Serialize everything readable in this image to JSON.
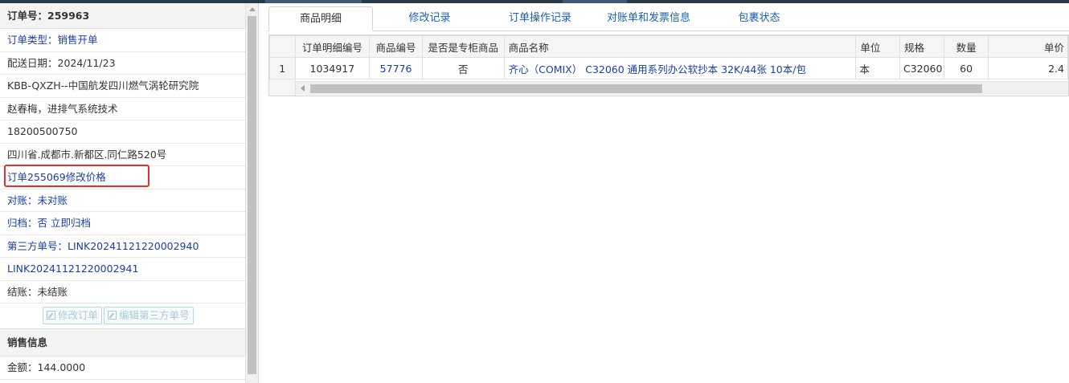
{
  "order": {
    "number_label": "订单号：259963",
    "type_label": "订单类型：",
    "type_value": "销售开单",
    "delivery_date": "配送日期：2024/11/23",
    "customer": "KBB-QXZH--中国航发四川燃气涡轮研究院",
    "contact": "赵春梅，进排气系统技术",
    "phone": "18200500750",
    "address": "四川省.成都市.新都区.同仁路520号",
    "price_change_link": "订单255069修改价格",
    "reconcile_label": "对账：",
    "reconcile_value": "未对账",
    "archive_label": "归档：",
    "archive_value": "否 立即归档",
    "third_party_label": "第三方单号：",
    "third_party_value_1": "LINK20241121220002940",
    "third_party_value_2": "LINK20241121220002941",
    "settle_label": "结账：",
    "settle_value": "未结账",
    "edit_order_button": "修改订单",
    "edit_third_party_button": "编辑第三方单号"
  },
  "sales_info": {
    "title": "销售信息",
    "amount": "金额：144.0000"
  },
  "tabs": [
    {
      "label": "商品明细",
      "active": true
    },
    {
      "label": "修改记录"
    },
    {
      "label": "订单操作记录"
    },
    {
      "label": "对账单和发票信息"
    },
    {
      "label": "包裹状态"
    }
  ],
  "grid": {
    "headers": [
      "订单明细编号",
      "商品编号",
      "是否是专柜商品",
      "商品名称",
      "单位",
      "规格",
      "数量",
      "单价"
    ],
    "rows": [
      {
        "rownum": "1",
        "detail_id": "1034917",
        "product_id": "57776",
        "counter": "否",
        "name": "齐心（COMIX） C32060 通用系列办公软抄本 32K/44张 10本/包",
        "unit": "本",
        "spec": "C32060",
        "qty": "60",
        "price": "2.4"
      }
    ]
  },
  "colors": {
    "link": "#1a3fa3",
    "highlight": "#e03030",
    "tab_text": "#1a5fb4"
  }
}
